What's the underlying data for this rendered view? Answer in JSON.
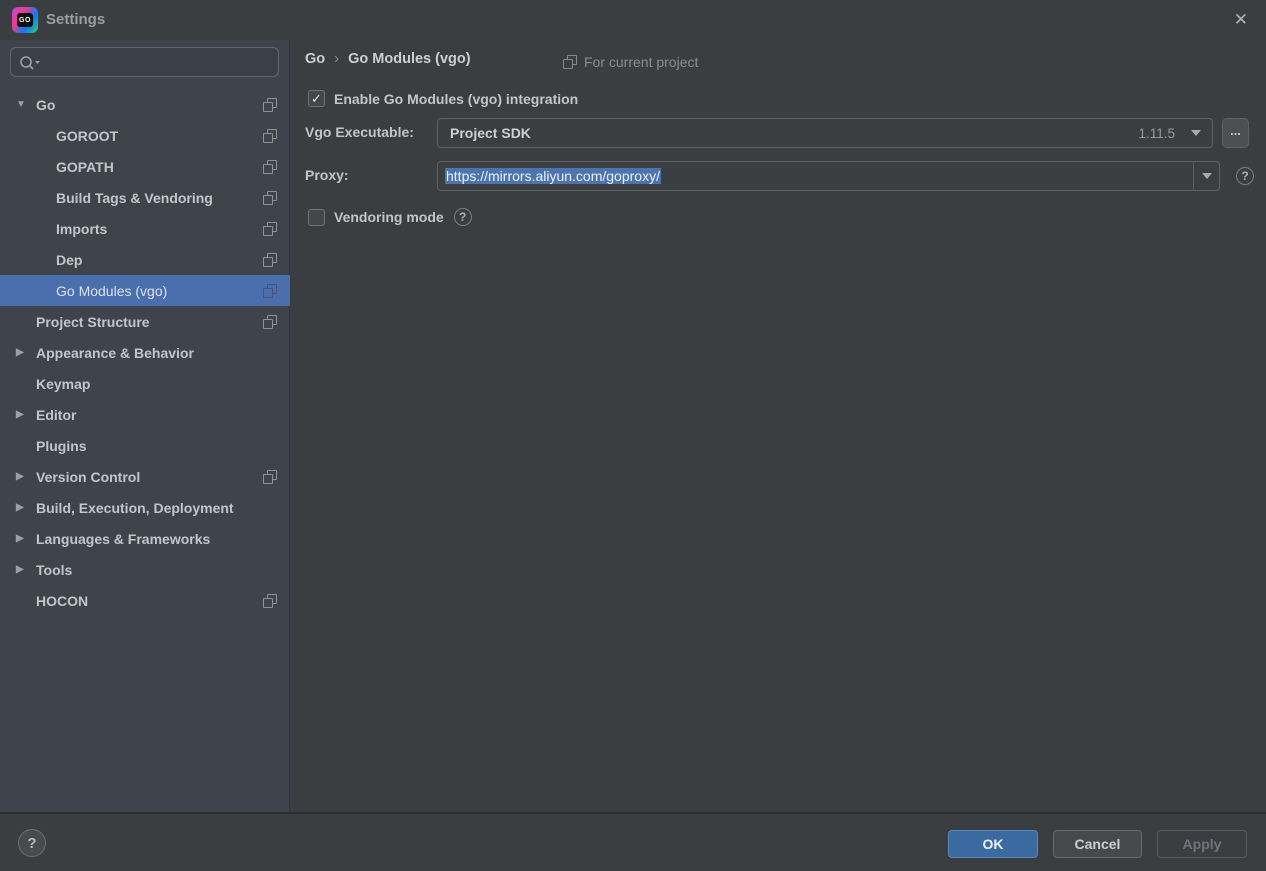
{
  "window": {
    "title": "Settings"
  },
  "icons": {
    "expanded": "▼",
    "collapsed": "▶",
    "check": "✓",
    "close": "✕",
    "question": "?",
    "breadcrumb_sep": "›",
    "ellipsis": "..."
  },
  "colors": {
    "selection_blue": "#4b6eaf",
    "ok_button_blue": "#3a6aa0",
    "sidebar_bg": "#3f434c",
    "panel_bg": "#3b3e40",
    "text_selection_bg": "#4e74ad"
  },
  "sidebar": {
    "search": {
      "value": "",
      "placeholder": ""
    },
    "tree": [
      {
        "label": "Go",
        "level": 0,
        "expander": "expanded",
        "icon": true
      },
      {
        "label": "GOROOT",
        "level": 1,
        "icon": true
      },
      {
        "label": "GOPATH",
        "level": 1,
        "icon": true
      },
      {
        "label": "Build Tags & Vendoring",
        "level": 1,
        "icon": true
      },
      {
        "label": "Imports",
        "level": 1,
        "icon": true
      },
      {
        "label": "Dep",
        "level": 1,
        "icon": true
      },
      {
        "label": "Go Modules (vgo)",
        "level": 1,
        "icon": true,
        "selected": true
      },
      {
        "label": "Project Structure",
        "level": 0,
        "icon": true
      },
      {
        "label": "Appearance & Behavior",
        "level": 0,
        "expander": "collapsed"
      },
      {
        "label": "Keymap",
        "level": 0
      },
      {
        "label": "Editor",
        "level": 0,
        "expander": "collapsed"
      },
      {
        "label": "Plugins",
        "level": 0
      },
      {
        "label": "Version Control",
        "level": 0,
        "expander": "collapsed",
        "icon": true
      },
      {
        "label": "Build, Execution, Deployment",
        "level": 0,
        "expander": "collapsed"
      },
      {
        "label": "Languages & Frameworks",
        "level": 0,
        "expander": "collapsed"
      },
      {
        "label": "Tools",
        "level": 0,
        "expander": "collapsed"
      },
      {
        "label": "HOCON",
        "level": 0,
        "icon": true
      }
    ]
  },
  "main": {
    "breadcrumb": {
      "parent": "Go",
      "current": "Go Modules (vgo)"
    },
    "scope_note": "For current project",
    "enable_checkbox": {
      "label": "Enable Go Modules (vgo) integration",
      "checked": true
    },
    "vgo_executable": {
      "label": "Vgo Executable:",
      "value": "Project SDK",
      "version": "1.11.5"
    },
    "proxy": {
      "label": "Proxy:",
      "value": "https://mirrors.aliyun.com/goproxy/"
    },
    "vendoring_checkbox": {
      "label": "Vendoring mode",
      "checked": false
    }
  },
  "footer": {
    "ok": "OK",
    "cancel": "Cancel",
    "apply": "Apply"
  }
}
